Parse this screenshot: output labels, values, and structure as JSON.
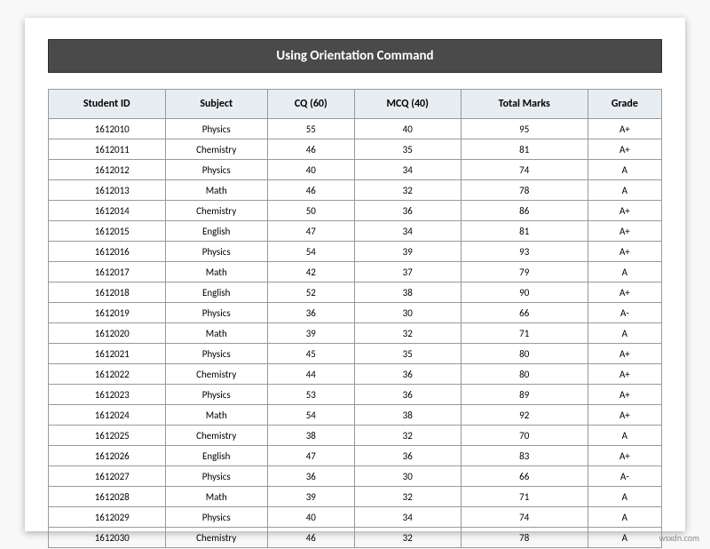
{
  "title": "Using Orientation Command",
  "columns": [
    "Student ID",
    "Subject",
    "CQ  (60)",
    "MCQ  (40)",
    "Total Marks",
    "Grade"
  ],
  "rows": [
    {
      "id": "1612010",
      "subject": "Physics",
      "cq": 55,
      "mcq": 40,
      "total": 95,
      "grade": "A+"
    },
    {
      "id": "1612011",
      "subject": "Chemistry",
      "cq": 46,
      "mcq": 35,
      "total": 81,
      "grade": "A+"
    },
    {
      "id": "1612012",
      "subject": "Physics",
      "cq": 40,
      "mcq": 34,
      "total": 74,
      "grade": "A"
    },
    {
      "id": "1612013",
      "subject": "Math",
      "cq": 46,
      "mcq": 32,
      "total": 78,
      "grade": "A"
    },
    {
      "id": "1612014",
      "subject": "Chemistry",
      "cq": 50,
      "mcq": 36,
      "total": 86,
      "grade": "A+"
    },
    {
      "id": "1612015",
      "subject": "English",
      "cq": 47,
      "mcq": 34,
      "total": 81,
      "grade": "A+"
    },
    {
      "id": "1612016",
      "subject": "Physics",
      "cq": 54,
      "mcq": 39,
      "total": 93,
      "grade": "A+"
    },
    {
      "id": "1612017",
      "subject": "Math",
      "cq": 42,
      "mcq": 37,
      "total": 79,
      "grade": "A"
    },
    {
      "id": "1612018",
      "subject": "English",
      "cq": 52,
      "mcq": 38,
      "total": 90,
      "grade": "A+"
    },
    {
      "id": "1612019",
      "subject": "Physics",
      "cq": 36,
      "mcq": 30,
      "total": 66,
      "grade": "A-"
    },
    {
      "id": "1612020",
      "subject": "Math",
      "cq": 39,
      "mcq": 32,
      "total": 71,
      "grade": "A"
    },
    {
      "id": "1612021",
      "subject": "Physics",
      "cq": 45,
      "mcq": 35,
      "total": 80,
      "grade": "A+"
    },
    {
      "id": "1612022",
      "subject": "Chemistry",
      "cq": 44,
      "mcq": 36,
      "total": 80,
      "grade": "A+"
    },
    {
      "id": "1612023",
      "subject": "Physics",
      "cq": 53,
      "mcq": 36,
      "total": 89,
      "grade": "A+"
    },
    {
      "id": "1612024",
      "subject": "Math",
      "cq": 54,
      "mcq": 38,
      "total": 92,
      "grade": "A+"
    },
    {
      "id": "1612025",
      "subject": "Chemistry",
      "cq": 38,
      "mcq": 32,
      "total": 70,
      "grade": "A"
    },
    {
      "id": "1612026",
      "subject": "English",
      "cq": 47,
      "mcq": 36,
      "total": 83,
      "grade": "A+"
    },
    {
      "id": "1612027",
      "subject": "Physics",
      "cq": 36,
      "mcq": 30,
      "total": 66,
      "grade": "A-"
    },
    {
      "id": "1612028",
      "subject": "Math",
      "cq": 39,
      "mcq": 32,
      "total": 71,
      "grade": "A"
    },
    {
      "id": "1612029",
      "subject": "Physics",
      "cq": 40,
      "mcq": 34,
      "total": 74,
      "grade": "A"
    },
    {
      "id": "1612030",
      "subject": "Chemistry",
      "cq": 46,
      "mcq": 32,
      "total": 78,
      "grade": "A"
    }
  ],
  "watermark": "wsxdn.com"
}
